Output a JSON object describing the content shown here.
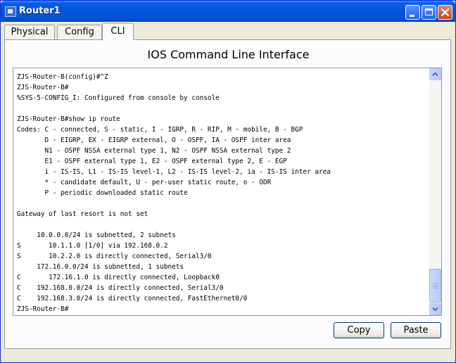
{
  "window": {
    "title": "Router1"
  },
  "tabs": [
    {
      "label": "Physical"
    },
    {
      "label": "Config"
    },
    {
      "label": "CLI"
    }
  ],
  "panel": {
    "title": "IOS Command Line Interface"
  },
  "console": {
    "text": "ZJS-Router-B(config)#^Z\nZJS-Router-B#\n%SYS-5-CONFIG_I: Configured from console by console\n\nZJS-Router-B#show ip route\nCodes: C - connected, S - static, I - IGRP, R - RIP, M - mobile, B - BGP\n       D - EIGRP, EX - EIGRP external, O - OSPF, IA - OSPF inter area\n       N1 - OSPF NSSA external type 1, N2 - OSPF NSSA external type 2\n       E1 - OSPF external type 1, E2 - OSPF external type 2, E - EGP\n       i - IS-IS, L1 - IS-IS level-1, L2 - IS-IS level-2, ia - IS-IS inter area\n       * - candidate default, U - per-user static route, o - ODR\n       P - periodic downloaded static route\n\nGateway of last resort is not set\n\n     10.0.0.0/24 is subnetted, 2 subnets\nS       10.1.1.0 [1/0] via 192.168.0.2\nS       10.2.2.0 is directly connected, Serial3/0\n     172.16.0.0/24 is subnetted, 1 subnets\nC       172.16.1.0 is directly connected, Loopback0\nC    192.168.0.0/24 is directly connected, Serial3/0\nC    192.168.3.0/24 is directly connected, FastEthernet0/0\nZJS-Router-B#"
  },
  "buttons": {
    "copy": "Copy",
    "paste": "Paste"
  },
  "icons": {
    "app": "router-app-icon",
    "minimize": "minimize-icon",
    "maximize": "maximize-icon",
    "close": "close-icon",
    "scroll_up": "arrow-up-icon",
    "scroll_down": "arrow-down-icon"
  }
}
